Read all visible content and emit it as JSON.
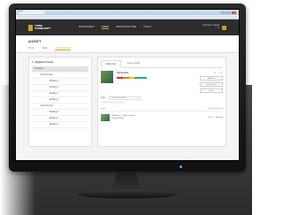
{
  "colors": {
    "accent": "#c9a227",
    "header_bg": "#2d2d2d",
    "color_bar": [
      "#c0392b",
      "#e67e22",
      "#f1c40f",
      "#27ae60",
      "#3498db"
    ]
  },
  "browser": {
    "tab_title": "Asset",
    "url": ""
  },
  "header": {
    "logo_text": "THINK COMMUNITY",
    "nav": [
      "MANAGEMENT",
      "ASSET",
      "INFRASTRUCTURE",
      "TOOLS"
    ],
    "active_nav_index": 1,
    "user_text": "Username Logged in"
  },
  "page": {
    "title": "ASSET",
    "subtabs": [
      "Home",
      "Work",
      "Asset Overview"
    ],
    "active_subtab_index": 2
  },
  "sidebar": {
    "title": "Organize Assets",
    "items": [
      {
        "label": "All Assets",
        "level": 0,
        "selected": true
      },
      {
        "label": "North Section",
        "level": 1
      },
      {
        "label": "Building 1",
        "level": 2
      },
      {
        "label": "Building 2",
        "level": 2
      },
      {
        "label": "Building 3",
        "level": 2
      },
      {
        "label": "Building 4",
        "level": 2
      },
      {
        "label": "South Section",
        "level": 1
      },
      {
        "label": "Building 5",
        "level": 2
      },
      {
        "label": "Building 6",
        "level": 2
      },
      {
        "label": "Building 7",
        "level": 2
      }
    ]
  },
  "main": {
    "tabs": [
      "Asset List",
      "Asset Details"
    ],
    "active_tab_index": 0,
    "asset": {
      "name": "All Assets",
      "actions": [
        "Add Asset",
        "Import Assets",
        "Export"
      ]
    },
    "filter": {
      "label": "Filter",
      "select_placeholder": "Select an option",
      "note": "Showing results for all assets"
    },
    "list_header": {
      "left": "Items",
      "right": "View Most Recent"
    },
    "list_items": [
      {
        "title": "Building 1 – North Section",
        "subtitle": "Ground Floor",
        "meta": "Oct 15 – Enabled"
      }
    ]
  }
}
